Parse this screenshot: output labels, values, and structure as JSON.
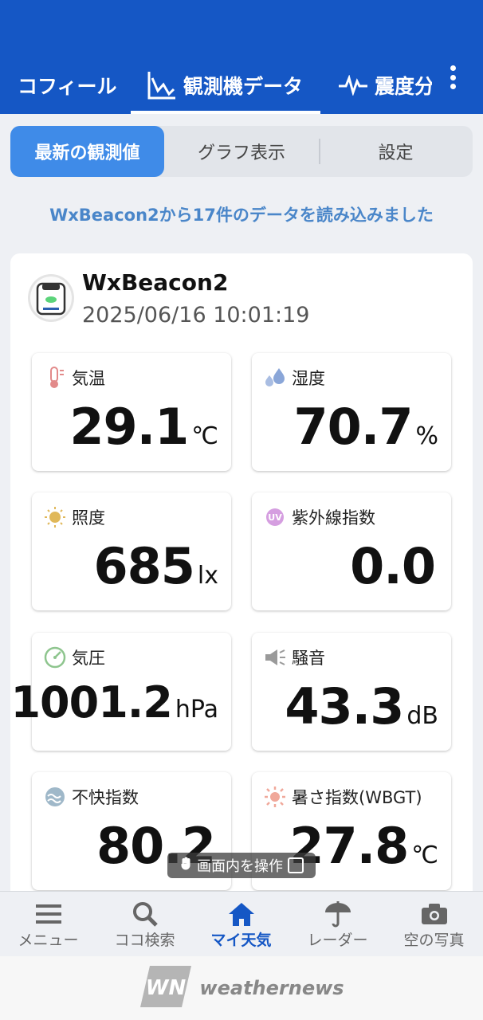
{
  "header": {
    "tabs": [
      {
        "label": "コフィール",
        "icon": "profile"
      },
      {
        "label": "観測機データ",
        "icon": "chart-icon"
      },
      {
        "label": "震度分",
        "icon": "pulse-icon"
      }
    ],
    "more_icon": "more-vertical-icon"
  },
  "segment": {
    "latest": "最新の観測値",
    "graph": "グラフ表示",
    "settings": "設定"
  },
  "status_message": "WxBeacon2から17件のデータを読み込みました",
  "device": {
    "name": "WxBeacon2",
    "timestamp": "2025/06/16 10:01:19"
  },
  "readings": {
    "temperature": {
      "label": "気温",
      "value": "29.1",
      "unit": "℃"
    },
    "humidity": {
      "label": "湿度",
      "value": "70.7",
      "unit": "%"
    },
    "illuminance": {
      "label": "照度",
      "value": "685",
      "unit": "lx"
    },
    "uv": {
      "label": "紫外線指数",
      "value": "0.0",
      "unit": ""
    },
    "pressure": {
      "label": "気圧",
      "value": "1001.2",
      "unit": "hPa"
    },
    "noise": {
      "label": "騒音",
      "value": "43.3",
      "unit": "dB"
    },
    "discomfort": {
      "label": "不快指数",
      "value": "80.2",
      "unit": ""
    },
    "wbgt": {
      "label": "暑さ指数(WBGT)",
      "value": "27.8",
      "unit": "℃"
    }
  },
  "overlay": {
    "label": "画面内を操作"
  },
  "bottom_nav": {
    "menu": "メニュー",
    "search": "ココ検索",
    "my_weather": "マイ天気",
    "radar": "レーダー",
    "sky_photo": "空の写真"
  },
  "ad": {
    "brand": "weathernews",
    "logo": "WN"
  },
  "colors": {
    "primary": "#1557c5",
    "segment_active": "#3f8be8",
    "status_text": "#4a86c9"
  }
}
